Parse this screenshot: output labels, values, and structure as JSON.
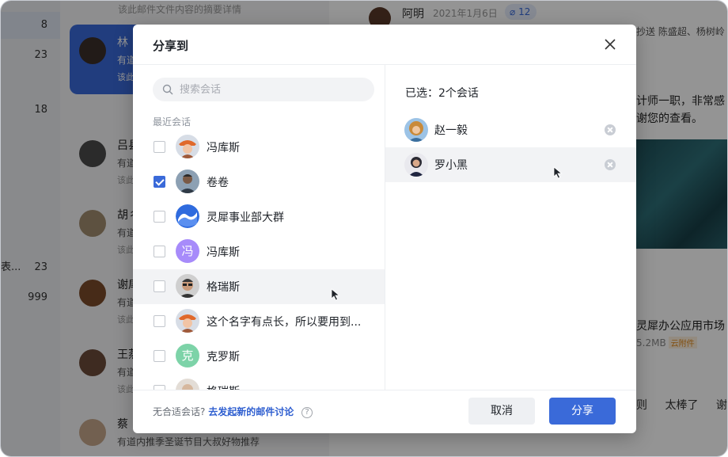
{
  "background": {
    "counts": [
      {
        "value": "8",
        "selected": true
      },
      {
        "value": "23"
      },
      {
        "value": "18"
      },
      {
        "value": "23",
        "label": "表..."
      },
      {
        "value": "999"
      }
    ],
    "summary_top": "该此邮件文件内容的摘要详情",
    "list_items": [
      {
        "name": "林",
        "line2": "有道",
        "line3": "该此",
        "selected": true
      },
      {
        "name": "吕县",
        "line2": "有道",
        "line3": "该此"
      },
      {
        "name": "胡彳",
        "line2": "有道",
        "line3": "该此"
      },
      {
        "name": "谢扉",
        "line2": "有道",
        "line3": "该此"
      },
      {
        "name": "王蒸",
        "line2": "有道",
        "line3": "该此"
      },
      {
        "name": "蔡",
        "line2": "有道内推季圣诞节目大叔好物推荐",
        "line3": ""
      }
    ],
    "detail": {
      "sender": "阿明",
      "date": "2021年1月6日",
      "attachment_count": "12",
      "cc": "抄送 陈盛超、杨树岭",
      "body_line1": "计师一职，非常感",
      "body_line2": "谢您的查看。",
      "file_name": "灵犀办公应用市场",
      "file_size": "5.2MB",
      "cloud_tag": "云附件",
      "quick_replies": [
        "则",
        "太棒了",
        "谢谢"
      ]
    }
  },
  "dialog": {
    "title": "分享到",
    "search_placeholder": "搜索会话",
    "section_label": "最近会话",
    "contacts": [
      {
        "name": "冯库斯",
        "checked": false,
        "avatar": "photo-orange-hat"
      },
      {
        "name": "卷卷",
        "checked": true,
        "avatar": "photo-man-dark"
      },
      {
        "name": "灵犀事业部大群",
        "checked": false,
        "avatar": "group-logo"
      },
      {
        "name": "冯库斯",
        "checked": false,
        "avatar": "letter",
        "letter": "冯",
        "color": "#a78bfa"
      },
      {
        "name": "格瑞斯",
        "checked": false,
        "avatar": "photo-man-glasses",
        "hover": true
      },
      {
        "name": "这个名字有点长，所以要用到...",
        "checked": false,
        "avatar": "photo-orange-hat"
      },
      {
        "name": "克罗斯",
        "checked": false,
        "avatar": "letter",
        "letter": "克",
        "color": "#7dd3a8"
      },
      {
        "name": "格瑞斯",
        "checked": false,
        "avatar": "photo-partial"
      }
    ],
    "selected_count_label": "已选：2个会话",
    "selected": [
      {
        "name": "赵一毅",
        "avatar": "photo-woman-curly"
      },
      {
        "name": "罗小黑",
        "avatar": "photo-woman-dark",
        "hover": true
      }
    ],
    "footer": {
      "prompt": "无合适会话?",
      "link": "去发起新的邮件讨论",
      "help": "?"
    },
    "cancel_label": "取消",
    "share_label": "分享"
  }
}
